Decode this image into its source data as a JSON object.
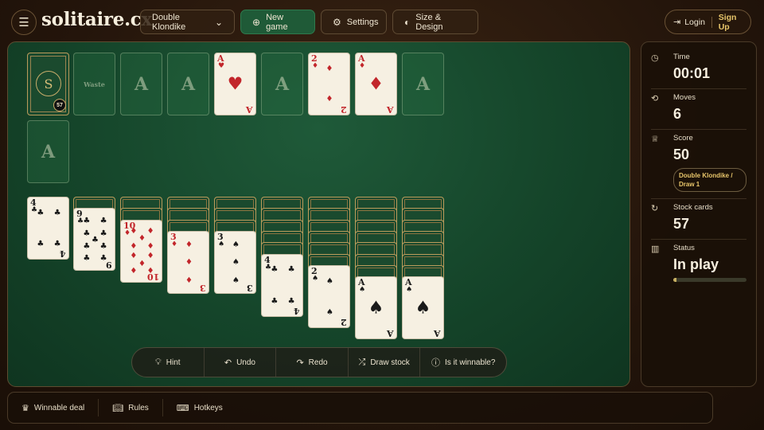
{
  "header": {
    "logo": "solitaire.cx",
    "game_select": "Double Klondike",
    "new_game": "New game",
    "settings": "Settings",
    "size_design": "Size & Design",
    "login": "Login",
    "signup": "Sign Up"
  },
  "stock": {
    "count": "57",
    "emblem": "S"
  },
  "slots": {
    "foundation_letter": "A",
    "waste_label": "Waste"
  },
  "foundations": [
    {
      "rank": "A",
      "suit": "♥",
      "color": "#c2262b"
    },
    {
      "rank": "2",
      "suit": "♦",
      "color": "#c2262b"
    },
    {
      "rank": "A",
      "suit": "♦",
      "color": "#c2262b"
    }
  ],
  "tableau": [
    {
      "face_down": 0,
      "cards": [
        {
          "rank": "4",
          "suit": "♣",
          "color": "#1a1a1a"
        }
      ]
    },
    {
      "face_down": 1,
      "cards": [
        {
          "rank": "9",
          "suit": "♣",
          "color": "#1a1a1a"
        }
      ]
    },
    {
      "face_down": 2,
      "cards": [
        {
          "rank": "10",
          "suit": "♦",
          "color": "#c2262b"
        }
      ]
    },
    {
      "face_down": 3,
      "cards": [
        {
          "rank": "3",
          "suit": "♦",
          "color": "#c2262b"
        }
      ]
    },
    {
      "face_down": 3,
      "cards": [
        {
          "rank": "3",
          "suit": "♠",
          "color": "#1a1a1a"
        }
      ]
    },
    {
      "face_down": 5,
      "cards": [
        {
          "rank": "4",
          "suit": "♣",
          "color": "#1a1a1a"
        }
      ]
    },
    {
      "face_down": 6,
      "cards": [
        {
          "rank": "2",
          "suit": "♠",
          "color": "#1a1a1a"
        }
      ]
    },
    {
      "face_down": 7,
      "cards": [
        {
          "rank": "A",
          "suit": "♠",
          "color": "#1a1a1a"
        }
      ]
    },
    {
      "face_down": 7,
      "cards": [
        {
          "rank": "A",
          "suit": "♠",
          "color": "#1a1a1a"
        }
      ]
    }
  ],
  "toolbar": {
    "hint": "Hint",
    "undo": "Undo",
    "redo": "Redo",
    "draw_stock": "Draw stock",
    "winnable": "Is it winnable?"
  },
  "side": {
    "time_label": "Time",
    "time": "00:01",
    "moves_label": "Moves",
    "moves": "6",
    "score_label": "Score",
    "score": "50",
    "mode_badge": "Double Klondike / Draw 1",
    "stock_label": "Stock cards",
    "stock": "57",
    "status_label": "Status",
    "status": "In play",
    "progress": 0.04
  },
  "footer": {
    "winnable_deal": "Winnable deal",
    "rules": "Rules",
    "hotkeys": "Hotkeys"
  }
}
